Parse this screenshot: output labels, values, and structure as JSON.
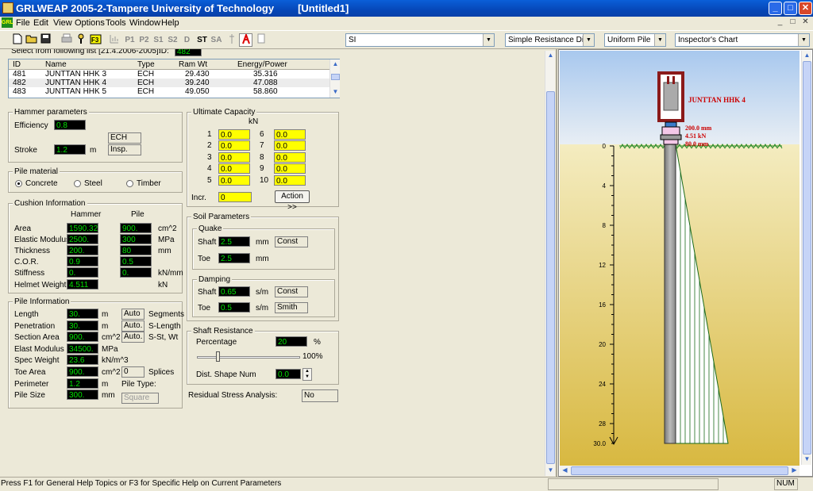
{
  "title": {
    "app": "GRLWEAP 2005-2-Tampere University of Technology",
    "doc": "[Untitled1]",
    "btn_min": "_",
    "btn_max": "□",
    "btn_close": "✕"
  },
  "menu": {
    "icon_text": "GRL",
    "items": [
      "File",
      "Edit",
      "View",
      "Options",
      "Tools",
      "Window",
      "Help"
    ],
    "mdi": [
      "_",
      "□",
      "✕"
    ]
  },
  "toolbar": {
    "buttons": [
      "P1",
      "P2",
      "S1",
      "S2",
      "D",
      "ST",
      "SA"
    ],
    "units_select": "SI",
    "resistance_select": "Simple Resistance Distr",
    "pile_select": "Uniform Pile",
    "chart_select": "Inspector's Chart"
  },
  "hammer_list": {
    "caption": "Select from following list [21.4.2006-2005]:",
    "id_label": "ID:",
    "id_value": "482",
    "columns": [
      "ID",
      "Name",
      "Type",
      "Ram Wt",
      "Energy/Power"
    ],
    "rows": [
      [
        "481",
        "JUNTTAN HHK 3",
        "ECH",
        "29.430",
        "35.316"
      ],
      [
        "482",
        "JUNTTAN HHK 4",
        "ECH",
        "39.240",
        "47.088"
      ],
      [
        "483",
        "JUNTTAN HHK 5",
        "ECH",
        "49.050",
        "58.860"
      ]
    ]
  },
  "hammer_params": {
    "title": "Hammer parameters",
    "efficiency_label": "Efficiency",
    "efficiency": "0.8",
    "stroke_label": "Stroke",
    "stroke": "1.2",
    "stroke_unit": "m",
    "type_value": "ECH",
    "insp_value": "Insp."
  },
  "pile_material": {
    "title": "Pile material",
    "options": [
      "Concrete",
      "Steel",
      "Timber"
    ],
    "selected": "Concrete"
  },
  "cushion": {
    "title": "Cushion Information",
    "col_hammer": "Hammer",
    "col_pile": "Pile",
    "rows": [
      {
        "label": "Area",
        "hammer": "1590.32",
        "pile": "900.",
        "unit": "cm^2"
      },
      {
        "label": "Elastic Modulus",
        "hammer": "2500.",
        "pile": "300",
        "unit": "MPa"
      },
      {
        "label": "Thickness",
        "hammer": "200.",
        "pile": "80",
        "unit": "mm"
      },
      {
        "label": "C.O.R.",
        "hammer": "0.9",
        "pile": "0.5",
        "unit": ""
      },
      {
        "label": "Stiffness",
        "hammer": "0.",
        "pile": "0.",
        "unit": "kN/mm"
      }
    ],
    "helmet_label": "Helmet Weight",
    "helmet": "4.511",
    "helmet_unit": "kN"
  },
  "pile_info": {
    "title": "Pile Information",
    "rows": [
      {
        "label": "Length",
        "value": "30.",
        "unit": "m",
        "extra": "Auto",
        "extra_label": "Segments"
      },
      {
        "label": "Penetration",
        "value": "30.",
        "unit": "m",
        "extra": "Auto.",
        "extra_label": "S-Length"
      },
      {
        "label": "Section Area",
        "value": "900.",
        "unit": "cm^2",
        "extra": "Auto.",
        "extra_label": "S-St, Wt"
      },
      {
        "label": "Elast Modulus",
        "value": "34500.",
        "unit": "MPa",
        "extra": "",
        "extra_label": ""
      },
      {
        "label": "Spec Weight",
        "value": "23.6",
        "unit": "kN/m^3",
        "extra": "",
        "extra_label": ""
      },
      {
        "label": "Toe Area",
        "value": "900.",
        "unit": "cm^2",
        "extra": "0",
        "extra_label": "Splices"
      },
      {
        "label": "Perimeter",
        "value": "1.2",
        "unit": "m",
        "extra": "",
        "extra_label": "Pile Type:"
      },
      {
        "label": "Pile Size",
        "value": "300.",
        "unit": "mm",
        "extra": "",
        "extra_label": ""
      }
    ],
    "pile_type": "Square"
  },
  "ultimate": {
    "title": "Ultimate Capacity",
    "unit": "kN",
    "nums": [
      "1",
      "2",
      "3",
      "4",
      "5",
      "6",
      "7",
      "8",
      "9",
      "10"
    ],
    "values": [
      "0.0",
      "0.0",
      "0.0",
      "0.0",
      "0.0",
      "0.0",
      "0.0",
      "0.0",
      "0.0",
      "0.0"
    ],
    "incr_label": "Incr.",
    "incr": "0",
    "action": "Action >>"
  },
  "soil": {
    "title": "Soil Parameters",
    "quake_title": "Quake",
    "quake": [
      {
        "label": "Shaft",
        "value": "2.5",
        "unit": "mm",
        "extra": "Const"
      },
      {
        "label": "Toe",
        "value": "2.5",
        "unit": "mm",
        "extra": ""
      }
    ],
    "damping_title": "Damping",
    "damping": [
      {
        "label": "Shaft",
        "value": "0.65",
        "unit": "s/m",
        "extra": "Const"
      },
      {
        "label": "Toe",
        "value": "0.5",
        "unit": "s/m",
        "extra": "Smith"
      }
    ]
  },
  "shaft_res": {
    "title": "Shaft Resistance",
    "pct_label": "Percentage",
    "pct": "20",
    "pct_unit": "%",
    "slider_max": "100%",
    "slider_value": 0.2,
    "dist_label": "Dist. Shape Num",
    "dist": "0.0"
  },
  "residual": {
    "label": "Residual Stress Analysis:",
    "value": "No"
  },
  "graph": {
    "hammer_name": "JUNTTAN HHK 4",
    "ann1": "200.0 mm",
    "ann2": "4.51 kN",
    "ann3": "80.0 mm",
    "depth_ticks": [
      "0",
      "4",
      "8",
      "12",
      "16",
      "20",
      "24",
      "28",
      "30.0"
    ]
  },
  "status": {
    "text": "Press F1 for General Help Topics or F3 for Specific Help on Current Parameters",
    "num": "NUM"
  },
  "colors": {
    "title": "#0a5fd8",
    "field_bg": "#000000",
    "field_text": "#00e000",
    "yellow": "#ffff00",
    "soil": "#e8d070",
    "sky": "#c8dcf0",
    "hammer": "#8b1a1a",
    "ann": "#cc0000"
  }
}
